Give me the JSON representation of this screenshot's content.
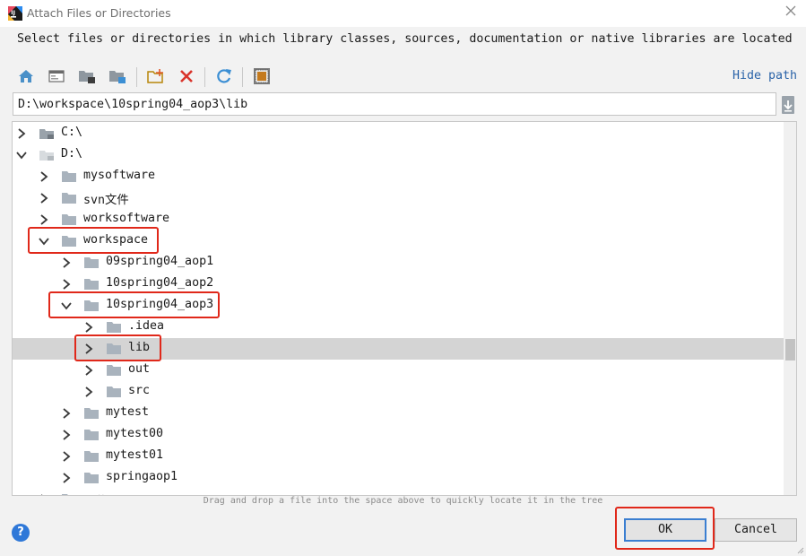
{
  "window": {
    "title": "Attach Files or Directories"
  },
  "description": "Select files or directories in which library classes, sources, documentation or native libraries are located",
  "toolbar": {
    "buttons": [
      {
        "icon": "home-icon"
      },
      {
        "icon": "desktop-icon"
      },
      {
        "icon": "project-folder-icon"
      },
      {
        "icon": "module-folder-icon"
      },
      {
        "icon": "new-folder-icon"
      },
      {
        "icon": "delete-icon"
      },
      {
        "icon": "refresh-icon"
      },
      {
        "icon": "show-hidden-icon"
      }
    ],
    "hide_path": "Hide path"
  },
  "path": {
    "value": "D:\\workspace\\10spring04_aop3\\lib"
  },
  "tree": {
    "rows": [
      {
        "label": "C:\\",
        "expanded": false,
        "kind": "drive"
      },
      {
        "label": "D:\\",
        "expanded": true,
        "kind": "drive"
      },
      {
        "label": "mysoftware",
        "expanded": false,
        "kind": "folder"
      },
      {
        "label": "svn文件",
        "expanded": false,
        "kind": "folder"
      },
      {
        "label": "worksoftware",
        "expanded": false,
        "kind": "folder"
      },
      {
        "label": "workspace",
        "expanded": true,
        "kind": "folder"
      },
      {
        "label": "09spring04_aop1",
        "expanded": false,
        "kind": "folder"
      },
      {
        "label": "10spring04_aop2",
        "expanded": false,
        "kind": "folder"
      },
      {
        "label": "10spring04_aop3",
        "expanded": true,
        "kind": "folder"
      },
      {
        "label": ".idea",
        "expanded": false,
        "kind": "folder"
      },
      {
        "label": "lib",
        "expanded": false,
        "kind": "folder",
        "selected": true
      },
      {
        "label": "out",
        "expanded": false,
        "kind": "folder"
      },
      {
        "label": "src",
        "expanded": false,
        "kind": "folder"
      },
      {
        "label": "mytest",
        "expanded": false,
        "kind": "folder"
      },
      {
        "label": "mytest00",
        "expanded": false,
        "kind": "folder"
      },
      {
        "label": "mytest01",
        "expanded": false,
        "kind": "folder"
      },
      {
        "label": "springaop1",
        "expanded": false,
        "kind": "folder"
      },
      {
        "label": "下载",
        "expanded": false,
        "kind": "folder"
      }
    ]
  },
  "drag_hint": "Drag and drop a file into the space above to quickly locate it in the tree",
  "buttons": {
    "ok": "OK",
    "cancel": "Cancel",
    "help": "?"
  },
  "colors": {
    "accent": "#2f78d8",
    "highlight_box": "#e0281a",
    "selection": "#d4d4d4",
    "folder": "#a9b3bd",
    "link": "#2a63a8"
  }
}
